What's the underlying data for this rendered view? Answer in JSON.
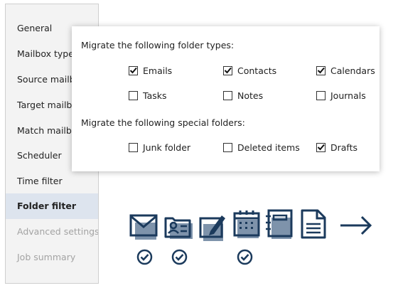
{
  "sidebar": {
    "items": [
      {
        "label": "General",
        "state": "normal"
      },
      {
        "label": "Mailbox types",
        "state": "normal"
      },
      {
        "label": "Source mailbox",
        "state": "normal"
      },
      {
        "label": "Target mailbox",
        "state": "normal"
      },
      {
        "label": "Match mailboxes",
        "state": "normal"
      },
      {
        "label": "Scheduler",
        "state": "normal"
      },
      {
        "label": "Time filter",
        "state": "normal"
      },
      {
        "label": "Folder filter",
        "state": "active"
      },
      {
        "label": "Advanced settings",
        "state": "disabled"
      },
      {
        "label": "Job summary",
        "state": "disabled"
      }
    ]
  },
  "panel": {
    "folder_types_label": "Migrate the following folder types:",
    "folder_types": [
      {
        "label": "Emails",
        "checked": true
      },
      {
        "label": "Contacts",
        "checked": true
      },
      {
        "label": "Calendars",
        "checked": true
      },
      {
        "label": "Tasks",
        "checked": false
      },
      {
        "label": "Notes",
        "checked": false
      },
      {
        "label": "Journals",
        "checked": false
      }
    ],
    "special_folders_label": "Migrate the following special folders:",
    "special_folders": [
      {
        "label": "Junk folder",
        "checked": false
      },
      {
        "label": "Deleted items",
        "checked": false
      },
      {
        "label": "Drafts",
        "checked": true
      }
    ]
  },
  "illustration": {
    "icons": [
      "mail-icon",
      "contact-card-icon",
      "notes-edit-icon",
      "calendar-icon",
      "journal-icon",
      "document-icon",
      "arrow-right-icon"
    ],
    "selected": [
      "mail-icon",
      "contact-card-icon",
      "calendar-icon"
    ],
    "colors": {
      "navy": "#1b3a5c",
      "steel": "#7e93ab"
    }
  }
}
